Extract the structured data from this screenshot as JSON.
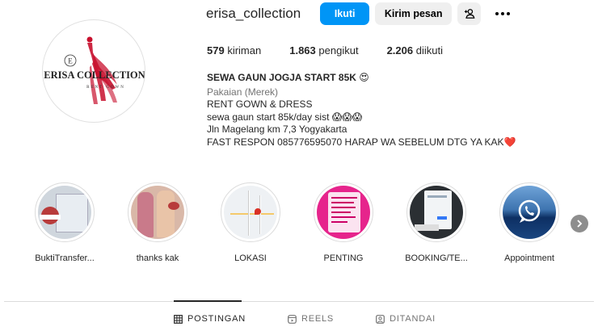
{
  "profile": {
    "username": "erisa_collection",
    "follow_label": "Ikuti",
    "message_label": "Kirim pesan",
    "logo_text": "ERISA COLLECTION",
    "logo_subtext": "RENT GOWN",
    "logo_monogram": "E"
  },
  "stats": [
    {
      "value": "579",
      "label": "kiriman"
    },
    {
      "value": "1.863",
      "label": "pengikut"
    },
    {
      "value": "2.206",
      "label": "diikuti"
    }
  ],
  "bio": {
    "name": "SEWA GAUN JOGJA START 85K 😍",
    "category": "Pakaian (Merek)",
    "lines": [
      "RENT GOWN & DRESS",
      "sewa gaun start 85k/day sist 😱😱😱",
      "Jln Magelang km 7,3 Yogyakarta",
      "FAST RESPON 085776595070 HARAP WA SEBELUM DTG YA KAK❤️"
    ]
  },
  "highlights": [
    {
      "label": "BuktiTransfer..."
    },
    {
      "label": "thanks kak"
    },
    {
      "label": "LOKASI"
    },
    {
      "label": "PENTING"
    },
    {
      "label": "BOOKING/TE..."
    },
    {
      "label": "Appointment"
    }
  ],
  "tabs": [
    {
      "label": "POSTINGAN"
    },
    {
      "label": "REELS"
    },
    {
      "label": "DITANDAI"
    }
  ],
  "colors": {
    "accent": "#0095f6",
    "logo_red": "#c8102e",
    "pink": "#e6248c"
  },
  "icons": {
    "add_user": "add-user-icon",
    "more": "more-options-icon",
    "next": "chevron-right-icon",
    "grid": "grid-icon",
    "reels": "reels-icon",
    "tagged": "tagged-icon"
  }
}
